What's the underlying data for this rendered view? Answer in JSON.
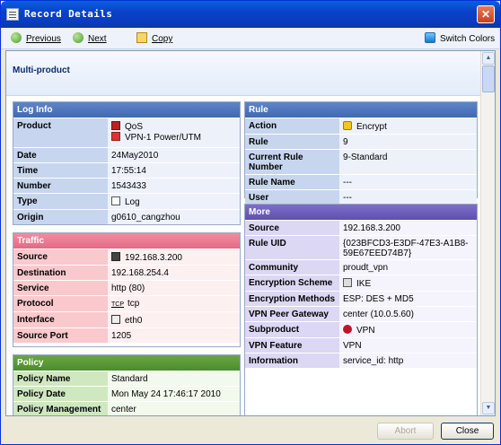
{
  "window": {
    "title": "Record Details",
    "close_glyph": "✕"
  },
  "toolbar": {
    "previous": "Previous",
    "next": "Next",
    "copy": "Copy",
    "switch_colors": "Switch Colors"
  },
  "header": {
    "product": "Multi-product"
  },
  "log_info": {
    "title": "Log Info",
    "rows": [
      {
        "key": "Product",
        "value": "QoS",
        "value2": "VPN-1 Power/UTM",
        "icon": "firewall-icon"
      },
      {
        "key": "Date",
        "value": "24May2010"
      },
      {
        "key": "Time",
        "value": "17:55:14"
      },
      {
        "key": "Number",
        "value": "1543433"
      },
      {
        "key": "Type",
        "value": "Log",
        "icon": "log-icon"
      },
      {
        "key": "Origin",
        "value": "g0610_cangzhou"
      }
    ]
  },
  "traffic": {
    "title": "Traffic",
    "rows": [
      {
        "key": "Source",
        "value": "192.168.3.200",
        "icon": "host-icon"
      },
      {
        "key": "Destination",
        "value": "192.168.254.4"
      },
      {
        "key": "Service",
        "value": "http (80)"
      },
      {
        "key": "Protocol",
        "value": "tcp",
        "tag": "TCP"
      },
      {
        "key": "Interface",
        "value": "eth0",
        "icon": "interface-icon"
      },
      {
        "key": "Source Port",
        "value": "1205"
      }
    ]
  },
  "policy": {
    "title": "Policy",
    "rows": [
      {
        "key": "Policy Name",
        "value": "Standard"
      },
      {
        "key": "Policy Date",
        "value": "Mon May 24 17:46:17 2010"
      },
      {
        "key": "Policy Management",
        "value": "center"
      }
    ]
  },
  "rule": {
    "title": "Rule",
    "rows": [
      {
        "key": "Action",
        "value": "Encrypt",
        "icon": "lock-icon"
      },
      {
        "key": "Rule",
        "value": "9"
      },
      {
        "key": "Current Rule Number",
        "value": "9-Standard"
      },
      {
        "key": "Rule Name",
        "value": "---"
      },
      {
        "key": "User",
        "value": "---"
      }
    ]
  },
  "more": {
    "title": "More",
    "rows": [
      {
        "key": "Source",
        "value": "192.168.3.200"
      },
      {
        "key": "Rule UID",
        "value": "{023BFCD3-E3DF-47E3-A1B8-",
        "value2": "59E67EED74B7}"
      },
      {
        "key": "Community",
        "value": "proudt_vpn"
      },
      {
        "key": "Encryption Scheme",
        "value": "IKE",
        "icon": "ike-icon"
      },
      {
        "key": "Encryption Methods",
        "value": "ESP: DES + MD5"
      },
      {
        "key": "VPN Peer Gateway",
        "value": "center (10.0.5.60)"
      },
      {
        "key": "Subproduct",
        "value": "VPN",
        "icon": "vpn-icon"
      },
      {
        "key": "VPN Feature",
        "value": "VPN"
      },
      {
        "key": "Information",
        "value": "service_id: http"
      }
    ]
  },
  "footer": {
    "abort": "Abort",
    "close": "Close"
  }
}
